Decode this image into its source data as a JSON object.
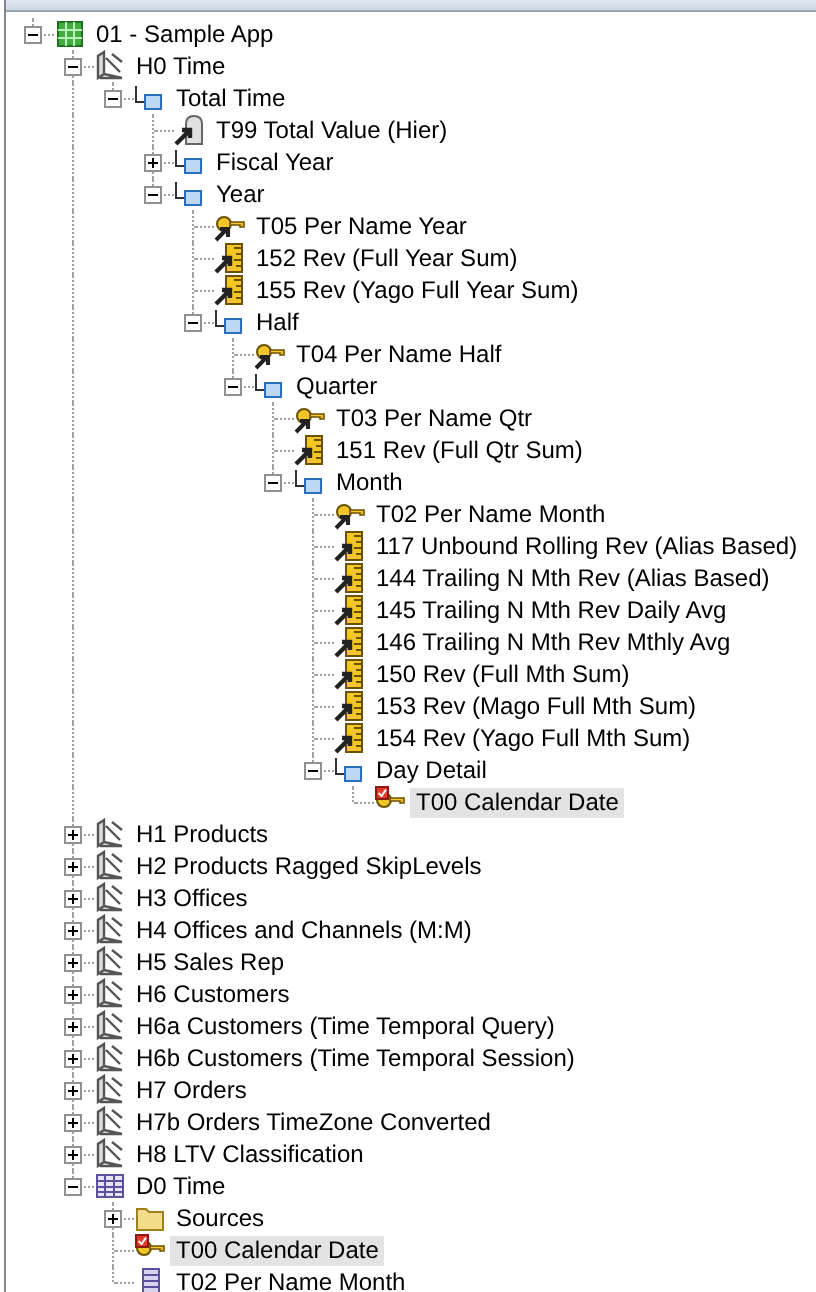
{
  "tree": [
    {
      "label": "01 - Sample App",
      "kind": "app",
      "expanded": true,
      "selected": false,
      "children": [
        {
          "label": "H0 Time",
          "kind": "hierarchy",
          "expanded": true,
          "selected": false,
          "children": [
            {
              "label": "Total Time",
              "kind": "level",
              "expanded": true,
              "selected": false,
              "children": [
                {
                  "label": "T99 Total Value (Hier)",
                  "kind": "total",
                  "selected": false
                },
                {
                  "label": "Fiscal Year",
                  "kind": "level",
                  "expanded": false,
                  "selected": false
                },
                {
                  "label": "Year",
                  "kind": "level",
                  "expanded": true,
                  "selected": false,
                  "children": [
                    {
                      "label": "T05 Per Name Year",
                      "kind": "key",
                      "selected": false
                    },
                    {
                      "label": "152  Rev  (Full Year Sum)",
                      "kind": "measure",
                      "selected": false
                    },
                    {
                      "label": "155  Rev  (Yago Full Year Sum)",
                      "kind": "measure",
                      "selected": false
                    },
                    {
                      "label": "Half",
                      "kind": "level",
                      "expanded": true,
                      "selected": false,
                      "children": [
                        {
                          "label": "T04 Per Name Half",
                          "kind": "key",
                          "selected": false
                        },
                        {
                          "label": "Quarter",
                          "kind": "level",
                          "expanded": true,
                          "selected": false,
                          "children": [
                            {
                              "label": "T03 Per Name Qtr",
                              "kind": "key",
                              "selected": false
                            },
                            {
                              "label": "151  Rev  (Full Qtr Sum)",
                              "kind": "measure",
                              "selected": false
                            },
                            {
                              "label": "Month",
                              "kind": "level",
                              "expanded": true,
                              "selected": false,
                              "children": [
                                {
                                  "label": "T02 Per Name Month",
                                  "kind": "key",
                                  "selected": false
                                },
                                {
                                  "label": "117  Unbound Rolling Rev  (Alias Based)",
                                  "kind": "measure",
                                  "selected": false
                                },
                                {
                                  "label": "144  Trailing N Mth Rev  (Alias Based)",
                                  "kind": "measure",
                                  "selected": false
                                },
                                {
                                  "label": "145  Trailing N Mth Rev Daily Avg",
                                  "kind": "measure",
                                  "selected": false
                                },
                                {
                                  "label": "146  Trailing N Mth Rev Mthly Avg",
                                  "kind": "measure",
                                  "selected": false
                                },
                                {
                                  "label": "150  Rev  (Full Mth Sum)",
                                  "kind": "measure",
                                  "selected": false
                                },
                                {
                                  "label": "153  Rev  (Mago Full Mth Sum)",
                                  "kind": "measure",
                                  "selected": false
                                },
                                {
                                  "label": "154  Rev  (Yago Full Mth Sum)",
                                  "kind": "measure",
                                  "selected": false
                                },
                                {
                                  "label": "Day Detail",
                                  "kind": "level",
                                  "expanded": true,
                                  "selected": false,
                                  "children": [
                                    {
                                      "label": "T00 Calendar Date",
                                      "kind": "primary_key",
                                      "selected": true
                                    }
                                  ]
                                }
                              ]
                            }
                          ]
                        }
                      ]
                    }
                  ]
                }
              ]
            }
          ]
        },
        {
          "label": "H1 Products",
          "kind": "hierarchy",
          "expanded": false,
          "selected": false
        },
        {
          "label": "H2 Products Ragged SkipLevels",
          "kind": "hierarchy",
          "expanded": false,
          "selected": false
        },
        {
          "label": "H3 Offices",
          "kind": "hierarchy",
          "expanded": false,
          "selected": false
        },
        {
          "label": "H4 Offices and Channels (M:M)",
          "kind": "hierarchy",
          "expanded": false,
          "selected": false
        },
        {
          "label": "H5 Sales Rep",
          "kind": "hierarchy",
          "expanded": false,
          "selected": false
        },
        {
          "label": "H6 Customers",
          "kind": "hierarchy",
          "expanded": false,
          "selected": false
        },
        {
          "label": "H6a Customers (Time Temporal Query)",
          "kind": "hierarchy",
          "expanded": false,
          "selected": false
        },
        {
          "label": "H6b Customers (Time Temporal Session)",
          "kind": "hierarchy",
          "expanded": false,
          "selected": false
        },
        {
          "label": "H7 Orders",
          "kind": "hierarchy",
          "expanded": false,
          "selected": false
        },
        {
          "label": "H7b Orders TimeZone Converted",
          "kind": "hierarchy",
          "expanded": false,
          "selected": false
        },
        {
          "label": "H8 LTV Classification",
          "kind": "hierarchy",
          "expanded": false,
          "selected": false
        },
        {
          "label": "D0 Time",
          "kind": "table",
          "expanded": true,
          "selected": false,
          "children": [
            {
              "label": "Sources",
              "kind": "folder",
              "expanded": false,
              "selected": false
            },
            {
              "label": "T00 Calendar Date",
              "kind": "primary_key",
              "selected": true
            },
            {
              "label": "T02 Per Name Month",
              "kind": "column",
              "selected": false
            }
          ]
        }
      ]
    }
  ]
}
